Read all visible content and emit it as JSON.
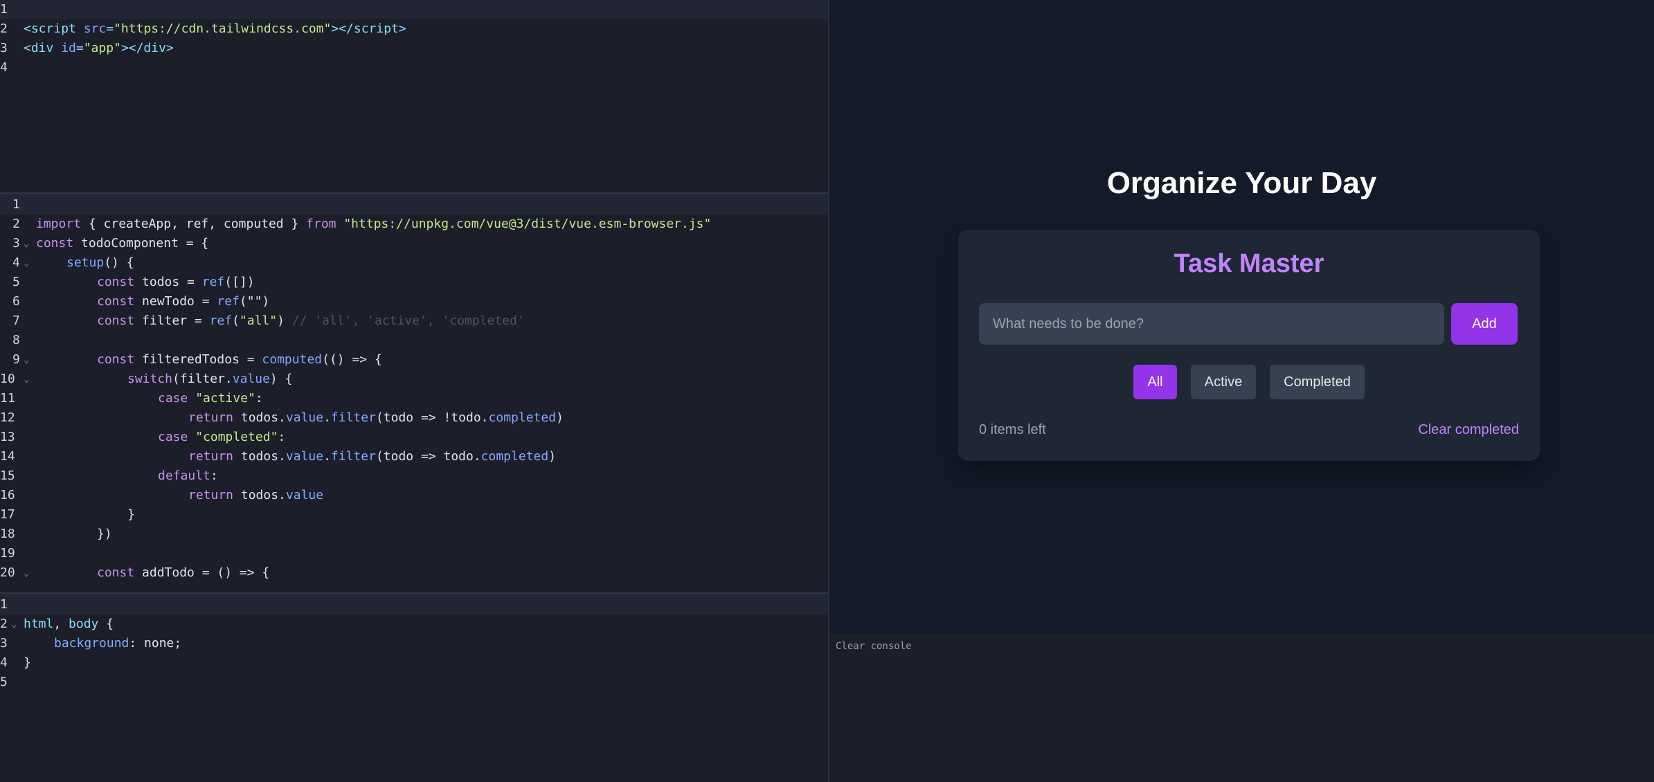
{
  "editor": {
    "html": {
      "line_numbers": [
        "1",
        "2",
        "3",
        "4"
      ],
      "lines": {
        "l2": {
          "lt": "<",
          "tag": "script",
          "attr": " src",
          "eq": "=",
          "val": "\"https://cdn.tailwindcss.com\"",
          "close": "></",
          "tag2": "script",
          "end": ">"
        },
        "l3": {
          "lt": "<",
          "tag": "div",
          "attr": " id",
          "eq": "=",
          "val": "\"app\"",
          "close": "></",
          "tag2": "div",
          "end": ">"
        }
      }
    },
    "js": {
      "line_numbers": [
        "1",
        "2",
        "3",
        "4",
        "5",
        "6",
        "7",
        "8",
        "9",
        "10",
        "11",
        "12",
        "13",
        "14",
        "15",
        "16",
        "17",
        "18",
        "19",
        "20"
      ],
      "l2": {
        "import": "import",
        "a": " { createApp, ref, computed } ",
        "from": "from",
        "s": " \"https://unpkg.com/vue@3/dist/vue.esm-browser.js\""
      },
      "l3": {
        "const": "const",
        "a": " todoComponent = {"
      },
      "l4": {
        "fn": "setup",
        "a": "() {"
      },
      "l5": {
        "const": "const",
        "a": " todos = ",
        "fn": "ref",
        "b": "([])"
      },
      "l6": {
        "const": "const",
        "a": " newTodo = ",
        "fn": "ref",
        "b": "(\"\")"
      },
      "l7": {
        "const": "const",
        "a": " filter = ",
        "fn": "ref",
        "b": "(",
        "s": "\"all\"",
        "c": ")",
        "cm": " // 'all', 'active', 'completed'"
      },
      "l9": {
        "const": "const",
        "a": " filteredTodos = ",
        "fn": "computed",
        "b": "(() => {"
      },
      "l10": {
        "kw": "switch",
        "a": "(filter.",
        "p": "value",
        "b": ") {"
      },
      "l11": {
        "kw": "case",
        "s": " \"active\"",
        "b": ":"
      },
      "l12": {
        "kw": "return",
        "a": " todos.",
        "p": "value",
        "d": ".",
        "f": "filter",
        "b": "(todo => !todo.",
        "p2": "completed",
        "c": ")"
      },
      "l13": {
        "kw": "case",
        "s": " \"completed\"",
        "b": ":"
      },
      "l14": {
        "kw": "return",
        "a": " todos.",
        "p": "value",
        "d": ".",
        "f": "filter",
        "b": "(todo => todo.",
        "p2": "completed",
        "c": ")"
      },
      "l15": {
        "kw": "default",
        "b": ":"
      },
      "l16": {
        "kw": "return",
        "a": " todos.",
        "p": "value"
      },
      "l17": {
        "a": "}"
      },
      "l18": {
        "a": "})"
      },
      "l20": {
        "const": "const",
        "a": " addTodo = () => {"
      }
    },
    "css": {
      "line_numbers": [
        "1",
        "2",
        "3",
        "4",
        "5"
      ],
      "l2": {
        "sel": "html",
        "a": ", ",
        "sel2": "body",
        "b": " {"
      },
      "l3": {
        "prop": "background",
        "a": ": none;"
      },
      "l4": {
        "a": "}"
      }
    }
  },
  "preview": {
    "heading": "Organize Your Day",
    "card_title": "Task Master",
    "input_placeholder": "What needs to be done?",
    "add_label": "Add",
    "filters": [
      "All",
      "Active",
      "Completed"
    ],
    "active_filter": "All",
    "items_left": "0 items left",
    "clear_completed": "Clear completed",
    "colors": {
      "accent": "#9333ea",
      "accent_text": "#c084fc",
      "bg": "#141a29",
      "card": "#1f2735"
    }
  },
  "console": {
    "clear_label": "Clear console"
  }
}
